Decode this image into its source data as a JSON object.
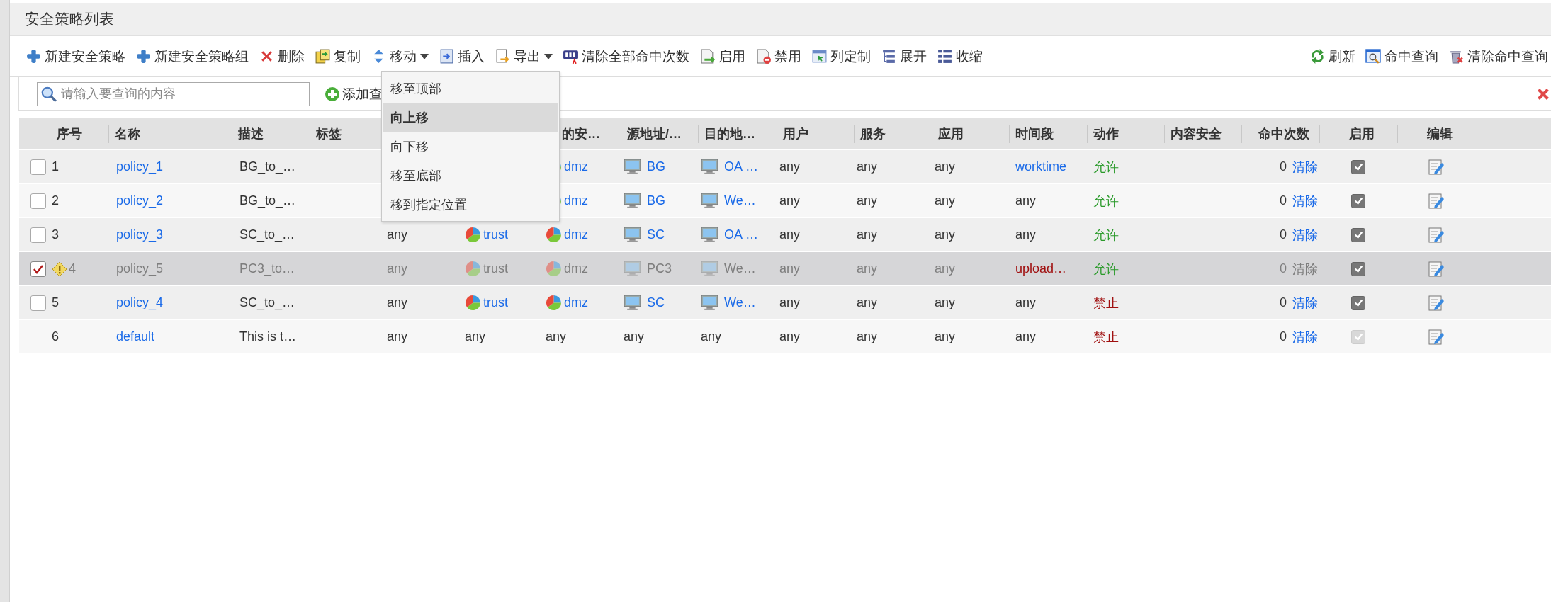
{
  "panel": {
    "title": "安全策略列表"
  },
  "toolbar": [
    {
      "label": "新建安全策略",
      "has_menu": false
    },
    {
      "label": "新建安全策略组",
      "has_menu": false
    },
    {
      "label": "删除",
      "has_menu": false
    },
    {
      "label": "复制",
      "has_menu": false
    },
    {
      "label": "移动",
      "has_menu": true
    },
    {
      "label": "插入",
      "has_menu": false
    },
    {
      "label": "导出",
      "has_menu": true
    },
    {
      "label": "清除全部命中次数",
      "has_menu": false
    },
    {
      "label": "启用",
      "has_menu": false
    },
    {
      "label": "禁用",
      "has_menu": false
    },
    {
      "label": "列定制",
      "has_menu": false
    },
    {
      "label": "展开",
      "has_menu": false
    },
    {
      "label": "收缩",
      "has_menu": false
    }
  ],
  "toolbar_right": [
    {
      "label": "刷新"
    },
    {
      "label": "命中查询"
    },
    {
      "label": "清除命中查询"
    }
  ],
  "search": {
    "placeholder": "请输入要查询的内容",
    "add_label": "添加查"
  },
  "move_menu": [
    {
      "label": "移至顶部",
      "selected": false
    },
    {
      "label": "向上移",
      "selected": true
    },
    {
      "label": "向下移",
      "selected": false
    },
    {
      "label": "移至底部",
      "selected": false
    },
    {
      "label": "移到指定位置",
      "selected": false
    }
  ],
  "columns": [
    "序号",
    "名称",
    "描述",
    "标签",
    null,
    null,
    "的安…",
    "源地址/…",
    "目的地…",
    "用户",
    "服务",
    "应用",
    "时间段",
    "动作",
    "内容安全",
    "命中次数",
    "启用",
    "编辑"
  ],
  "rows": [
    {
      "has_checkbox": true,
      "checked": false,
      "disabled": false,
      "warning": false,
      "seq": "1",
      "name": "policy_1",
      "desc": "BG_to_…",
      "dst_zone": {
        "text": "dmz",
        "kind": "zone"
      },
      "src_addr": {
        "text": "BG",
        "kind": "addr"
      },
      "dst_addr": {
        "text": "OA …",
        "kind": "addr"
      },
      "user": "any",
      "service": "any",
      "app": "any",
      "time": {
        "text": "worktime",
        "color": "#1a6ae8"
      },
      "action": {
        "text": "允许",
        "color": "#2a9a2a"
      },
      "hits": "0",
      "clear": "清除",
      "enabled": true,
      "enabled_locked": false
    },
    {
      "has_checkbox": true,
      "checked": false,
      "disabled": false,
      "warning": false,
      "seq": "2",
      "name": "policy_2",
      "desc": "BG_to_…",
      "dst_zone": {
        "text": "dmz",
        "kind": "zone"
      },
      "src_addr": {
        "text": "BG",
        "kind": "addr"
      },
      "dst_addr": {
        "text": "We…",
        "kind": "addr"
      },
      "user": "any",
      "service": "any",
      "app": "any",
      "time": {
        "text": "any",
        "color": "#333333"
      },
      "action": {
        "text": "允许",
        "color": "#2a9a2a"
      },
      "hits": "0",
      "clear": "清除",
      "enabled": true,
      "enabled_locked": false
    },
    {
      "has_checkbox": true,
      "checked": false,
      "disabled": false,
      "warning": false,
      "seq": "3",
      "name": "policy_3",
      "desc": "SC_to_…",
      "col5": {
        "text": "any",
        "kind": "plain"
      },
      "src_zone": {
        "text": "trust",
        "kind": "zone"
      },
      "dst_zone": {
        "text": "dmz",
        "kind": "zone"
      },
      "src_addr": {
        "text": "SC",
        "kind": "addr"
      },
      "dst_addr": {
        "text": "OA …",
        "kind": "addr"
      },
      "user": "any",
      "service": "any",
      "app": "any",
      "time": {
        "text": "any",
        "color": "#333333"
      },
      "action": {
        "text": "允许",
        "color": "#2a9a2a"
      },
      "hits": "0",
      "clear": "清除",
      "enabled": true,
      "enabled_locked": false
    },
    {
      "has_checkbox": true,
      "checked": true,
      "disabled": true,
      "warning": true,
      "seq": "4",
      "name": "policy_5",
      "desc": "PC3_to…",
      "col5": {
        "text": "any",
        "kind": "plain"
      },
      "src_zone": {
        "text": "trust",
        "kind": "zone"
      },
      "dst_zone": {
        "text": "dmz",
        "kind": "zone"
      },
      "src_addr": {
        "text": "PC3",
        "kind": "addr"
      },
      "dst_addr": {
        "text": "We…",
        "kind": "addr"
      },
      "user": "any",
      "service": "any",
      "app": "any",
      "time": {
        "text": "upload…",
        "color": "#a01010"
      },
      "action": {
        "text": "允许",
        "color": "#2a9a2a"
      },
      "hits": "0",
      "clear": "清除",
      "enabled": true,
      "enabled_locked": false
    },
    {
      "has_checkbox": true,
      "checked": false,
      "disabled": false,
      "warning": false,
      "seq": "5",
      "name": "policy_4",
      "desc": "SC_to_…",
      "col5": {
        "text": "any",
        "kind": "plain"
      },
      "src_zone": {
        "text": "trust",
        "kind": "zone"
      },
      "dst_zone": {
        "text": "dmz",
        "kind": "zone"
      },
      "src_addr": {
        "text": "SC",
        "kind": "addr"
      },
      "dst_addr": {
        "text": "We…",
        "kind": "addr"
      },
      "user": "any",
      "service": "any",
      "app": "any",
      "time": {
        "text": "any",
        "color": "#333333"
      },
      "action": {
        "text": "禁止",
        "color": "#a01010"
      },
      "hits": "0",
      "clear": "清除",
      "enabled": true,
      "enabled_locked": false
    },
    {
      "has_checkbox": false,
      "disabled": false,
      "warning": false,
      "seq": "6",
      "name": "default",
      "desc": "This is t…",
      "col5": {
        "text": "any",
        "kind": "plain"
      },
      "src_zone": {
        "text": "any",
        "kind": "plain"
      },
      "dst_zone": {
        "text": "any",
        "kind": "plain"
      },
      "src_addr": {
        "text": "any",
        "kind": "plain"
      },
      "dst_addr": {
        "text": "any",
        "kind": "plain"
      },
      "user": "any",
      "service": "any",
      "app": "any",
      "time": {
        "text": "any",
        "color": "#333333"
      },
      "action": {
        "text": "禁止",
        "color": "#a01010"
      },
      "hits": "0",
      "clear": "清除",
      "enabled": true,
      "enabled_locked": true
    }
  ]
}
